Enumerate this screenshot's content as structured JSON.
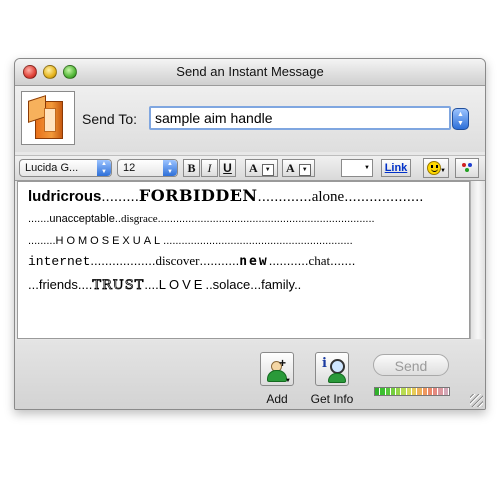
{
  "window": {
    "title": "Send an Instant Message"
  },
  "header": {
    "send_to_label": "Send To:",
    "send_to_value": "sample aim handle"
  },
  "toolbar": {
    "font": "Lucida G...",
    "size": "12",
    "bold": "B",
    "italic": "I",
    "underline": "U",
    "text_color_label": "A",
    "bg_color_label": "A",
    "link": "Link"
  },
  "message": {
    "line1": [
      {
        "text": "ludricrous",
        "style": "bold"
      },
      {
        "text": ".........",
        "style": "plain"
      },
      {
        "text": "FORBIDDEN",
        "style": "serifbold"
      },
      {
        "text": ".............",
        "style": "plain"
      },
      {
        "text": "alone",
        "style": "serif"
      },
      {
        "text": "...................",
        "style": "plain"
      }
    ],
    "line2": [
      {
        "text": ".......unacceptable..",
        "style": "plain"
      },
      {
        "text": "disgrace",
        "style": "serif"
      },
      {
        "text": ".......................................................................",
        "style": "plain"
      }
    ],
    "line3": [
      {
        "text": ".........",
        "style": "plain"
      },
      {
        "text": "HOMOSEXUAL",
        "style": "spaced"
      },
      {
        "text": "..............................................................",
        "style": "plain"
      }
    ],
    "line4": [
      {
        "text": "internet",
        "style": "mono"
      },
      {
        "text": "..................",
        "style": "plain"
      },
      {
        "text": "discover",
        "style": "serif"
      },
      {
        "text": "...........",
        "style": "plain"
      },
      {
        "text": "new",
        "style": "wide"
      },
      {
        "text": "...........",
        "style": "plain"
      },
      {
        "text": "chat",
        "style": "serif"
      },
      {
        "text": ".......",
        "style": "plain"
      }
    ],
    "line5": [
      {
        "text": "...friends....",
        "style": "plain"
      },
      {
        "text": "TRUST",
        "style": "outline"
      },
      {
        "text": "....",
        "style": "plain"
      },
      {
        "text": "LOVE",
        "style": "spaced"
      },
      {
        "text": "..solace...family..",
        "style": "plain"
      }
    ]
  },
  "bottom": {
    "add_label": "Add",
    "get_info_label": "Get Info",
    "send_label": "Send"
  },
  "colors": {
    "focus_ring": "#7fa6e0",
    "stepper_blue": "#2d6fd8",
    "meter": [
      "#2fb02a",
      "#3cc030",
      "#56c83a",
      "#74cf3e",
      "#96d648",
      "#b8dc52",
      "#d6dc58",
      "#e8cc58",
      "#eeb25a",
      "#ee9860",
      "#ec8a6a",
      "#e48a80",
      "#dc98a0",
      "#d4a8b8"
    ]
  }
}
